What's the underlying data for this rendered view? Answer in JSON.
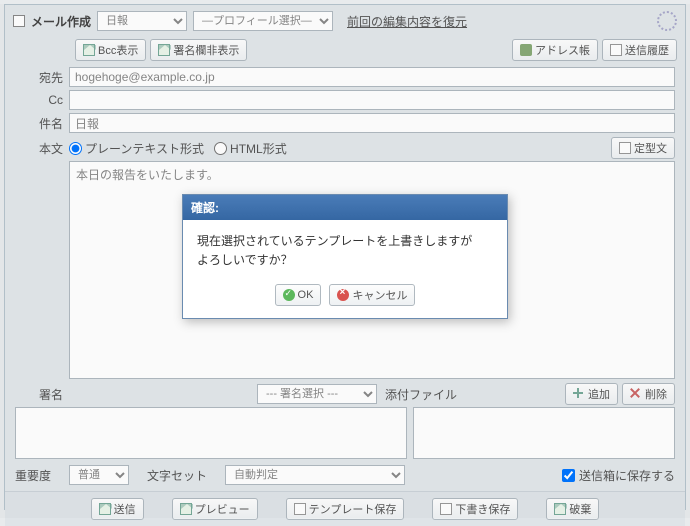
{
  "header": {
    "title": "メール作成",
    "type_select": "日報",
    "profile_select": "―プロフィール選択―",
    "restore_link": "前回の編集内容を復元"
  },
  "toolbar": {
    "bcc_show": "Bcc表示",
    "signature_hide": "署名欄非表示",
    "address_book": "アドレス帳",
    "send_history": "送信履歴"
  },
  "fields": {
    "to_label": "宛先",
    "to_value": "hogehoge@example.co.jp",
    "cc_label": "Cc",
    "cc_value": "",
    "subject_label": "件名",
    "subject_value": "日報"
  },
  "body": {
    "label": "本文",
    "plain_radio": "プレーンテキスト形式",
    "html_radio": "HTML形式",
    "template_text_btn": "定型文",
    "content": "本日の報告をいたします。"
  },
  "signature": {
    "label": "署名",
    "select": "--- 署名選択 ---"
  },
  "attachment": {
    "label": "添付ファイル",
    "add_btn": "追加",
    "delete_btn": "削除"
  },
  "options": {
    "priority_label": "重要度",
    "priority_value": "普通",
    "charset_label": "文字セット",
    "charset_value": "自動判定",
    "save_sent_label": "送信箱に保存する"
  },
  "actions": {
    "send": "送信",
    "preview": "プレビュー",
    "save_template": "テンプレート保存",
    "save_draft": "下書き保存",
    "discard": "破棄"
  },
  "modal": {
    "title": "確認:",
    "message_line1": "現在選択されているテンプレートを上書きしますが",
    "message_line2": "よろしいですか？",
    "ok": "OK",
    "cancel": "キャンセル"
  }
}
